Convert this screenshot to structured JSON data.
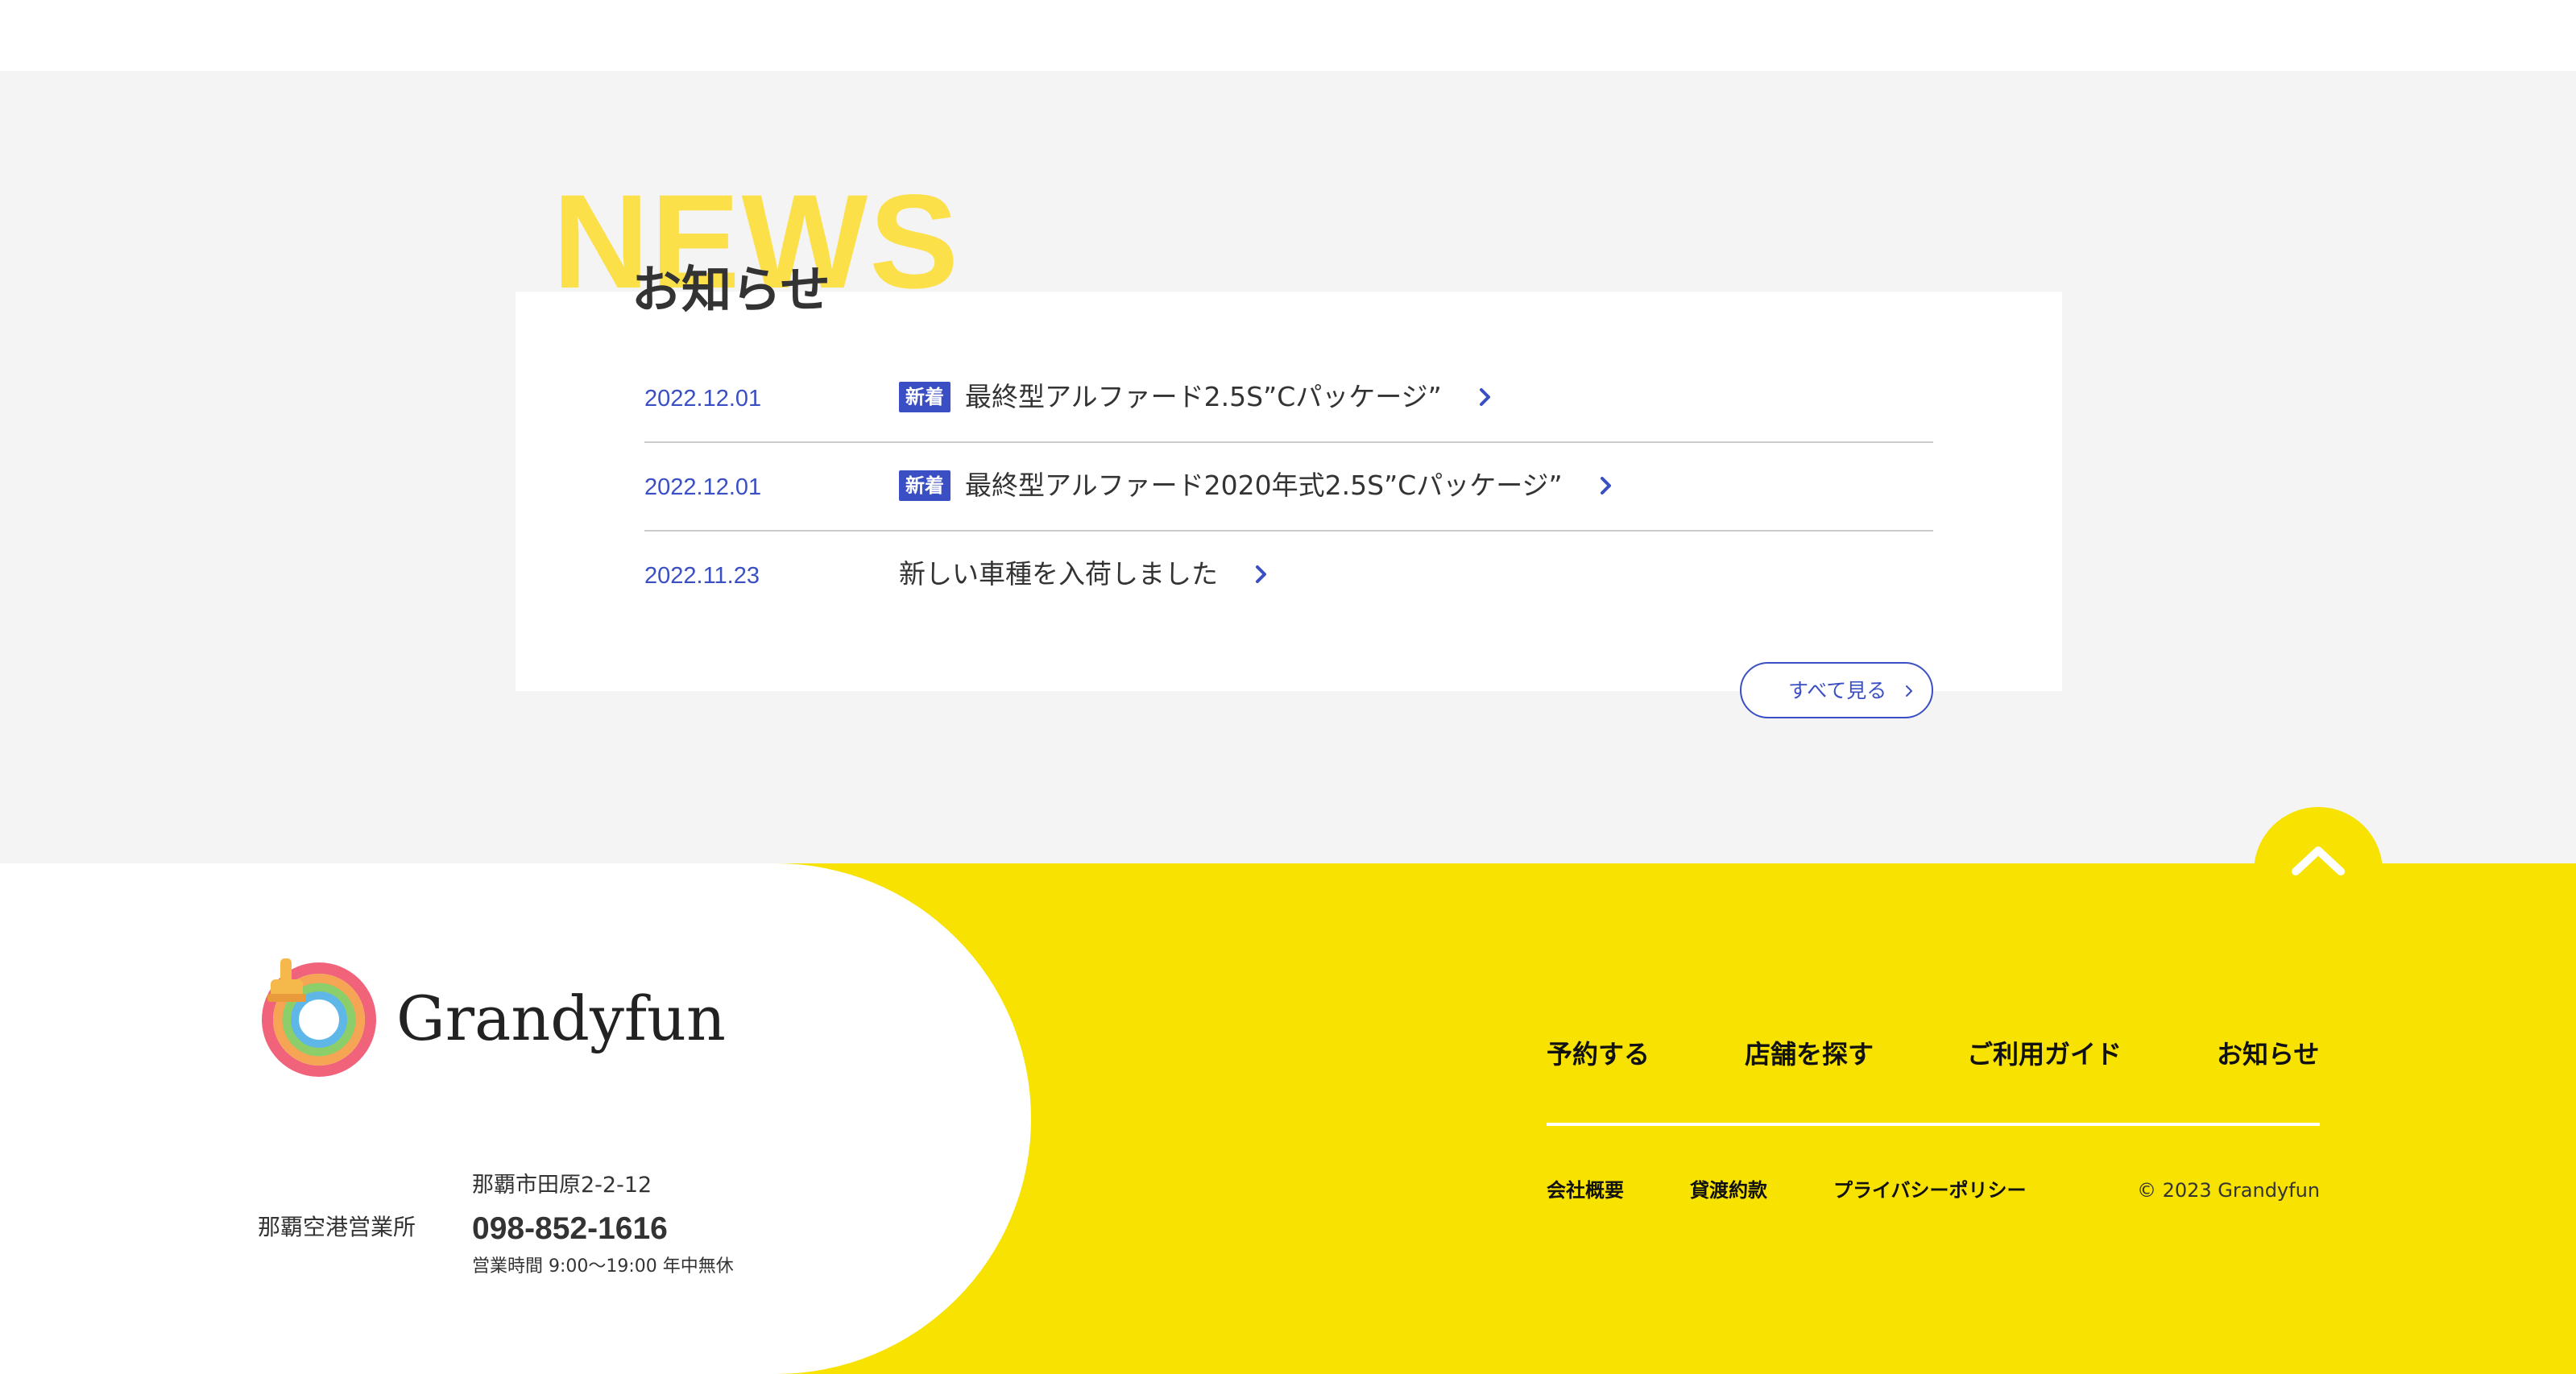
{
  "news": {
    "big_label": "NEWS",
    "heading": "お知らせ",
    "items": [
      {
        "date": "2022.12.01",
        "badge": "新着",
        "title": "最終型アルファード2.5S”Cパッケージ”"
      },
      {
        "date": "2022.12.01",
        "badge": "新着",
        "title": "最終型アルファード2020年式2.5S”Cパッケージ”"
      },
      {
        "date": "2022.11.23",
        "badge": "",
        "title": "新しい車種を入荷しました"
      }
    ],
    "see_all_label": "すべて見る"
  },
  "footer": {
    "logo_text": "Grandyfun",
    "office": {
      "name": "那覇空港営業所",
      "address": "那覇市田原2-2-12",
      "phone": "098-852-1616",
      "hours": "営業時間 9:00〜19:00 年中無休"
    },
    "nav": [
      "予約する",
      "店舗を探す",
      "ご利用ガイド",
      "お知らせ"
    ],
    "sub_nav": [
      "会社概要",
      "貸渡約款",
      "プライバシーポリシー"
    ],
    "copyright": "© 2023 Grandyfun"
  },
  "colors": {
    "accent_yellow": "#f7e202",
    "news_label_yellow": "#fbe04a",
    "link_blue": "#3a4fc4",
    "section_gray": "#f4f4f4"
  },
  "icons": {
    "news_row": "chevron-right-icon",
    "see_all": "chevron-right-icon",
    "to_top": "chevron-up-icon",
    "logo": "rainbow-ring-logo-icon"
  }
}
